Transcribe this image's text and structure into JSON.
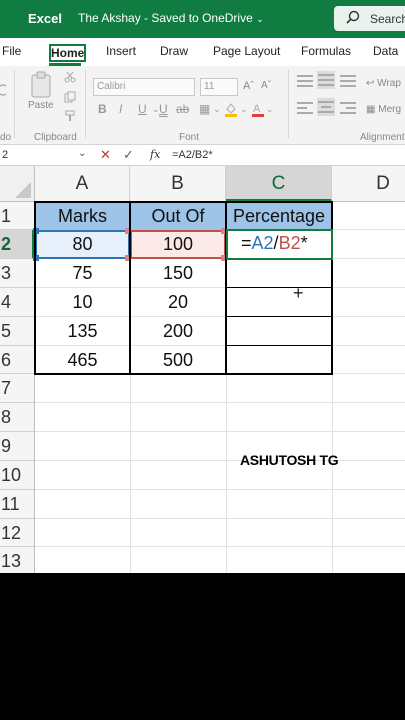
{
  "app": {
    "name": "Excel",
    "document": "The Akshay  -  Saved to OneDrive",
    "search_label": "Search"
  },
  "tabs": [
    {
      "label": "File"
    },
    {
      "label": "Home"
    },
    {
      "label": "Insert"
    },
    {
      "label": "Draw"
    },
    {
      "label": "Page Layout"
    },
    {
      "label": "Formulas"
    },
    {
      "label": "Data"
    }
  ],
  "ribbon": {
    "paste_label": "Paste",
    "clipboard_label": "Clipboard",
    "font_name": "Calibri",
    "font_size": "11",
    "font_group_label": "Font",
    "alignment_label": "Alignment",
    "wrap_label": "Wrap",
    "merge_label": "Merg",
    "undo_fragment": "do"
  },
  "formula_bar": {
    "name_box": "2",
    "fx_label": "fx",
    "formula": "=A2/B2*"
  },
  "columns": [
    {
      "label": "A"
    },
    {
      "label": "B"
    },
    {
      "label": "C"
    },
    {
      "label": "D"
    }
  ],
  "rows": [
    "1",
    "2",
    "3",
    "4",
    "5",
    "6",
    "7",
    "8",
    "9",
    "10",
    "11",
    "12",
    "13"
  ],
  "table": {
    "headers": [
      "Marks",
      "Out Of",
      "Percentage"
    ],
    "rows": [
      [
        "80",
        "100"
      ],
      [
        "75",
        "150"
      ],
      [
        "10",
        "20"
      ],
      [
        "135",
        "200"
      ],
      [
        "465",
        "500"
      ]
    ]
  },
  "editing_cell": {
    "prefix": "=",
    "ref_a": "A2",
    "slash": "/",
    "ref_b": "B2",
    "suffix": "*"
  },
  "watermark": "ASHUTOSH TG",
  "colors": {
    "excel_green": "#107c41",
    "header_fill": "#9dc3e6",
    "ref_a": "#2e75b6",
    "ref_b": "#c0504d"
  }
}
